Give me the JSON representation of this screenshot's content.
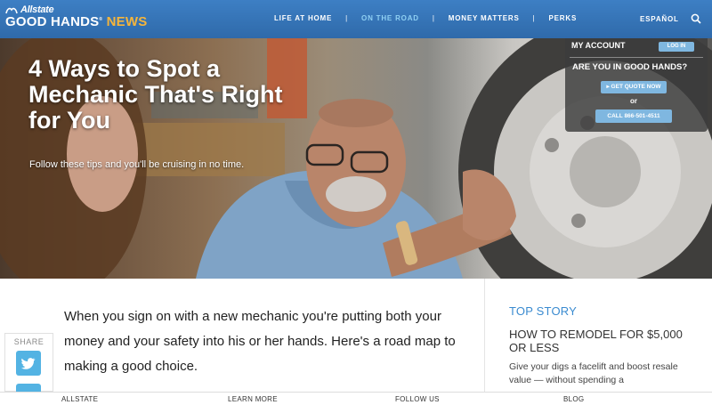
{
  "header": {
    "brand": "Allstate",
    "title_main": "GOOD HANDS",
    "title_accent": "NEWS",
    "nav": [
      {
        "label": "LIFE AT HOME",
        "active": false
      },
      {
        "label": "ON THE ROAD",
        "active": true
      },
      {
        "label": "MONEY MATTERS",
        "active": false
      },
      {
        "label": "PERKS",
        "active": false
      }
    ],
    "nav_separator": "|",
    "language": "ESPAÑOL",
    "search_icon": "search-icon"
  },
  "hero": {
    "headline": "4 Ways to Spot a Mechanic That's Right for You",
    "subhead": "Follow these tips and you'll be cruising in no time."
  },
  "account": {
    "my_account": "MY ACCOUNT",
    "login": "LOG IN",
    "question": "ARE YOU IN GOOD HANDS?",
    "quote_button": "GET QUOTE NOW",
    "or": "or",
    "call_button": "CALL 866-501-4511"
  },
  "article": {
    "lead": "When you sign on with a new mechanic you're putting both your money and your safety into his or her hands. Here's a road map to making a good choice."
  },
  "share": {
    "label": "SHARE",
    "icons": [
      "twitter-icon"
    ]
  },
  "sidebar": {
    "kicker": "TOP STORY",
    "title": "HOW TO REMODEL FOR $5,000 OR LESS",
    "description": "Give your digs a facelift and boost resale value — without spending a"
  },
  "footer": {
    "items": [
      "ALLSTATE",
      "LEARN MORE",
      "FOLLOW US",
      "BLOG"
    ]
  },
  "colors": {
    "header_blue": "#3574b8",
    "news_accent": "#f6b53b",
    "active_nav": "#8fd0f3",
    "button_blue": "#7fb7e0",
    "kicker_blue": "#3a8bd0"
  }
}
